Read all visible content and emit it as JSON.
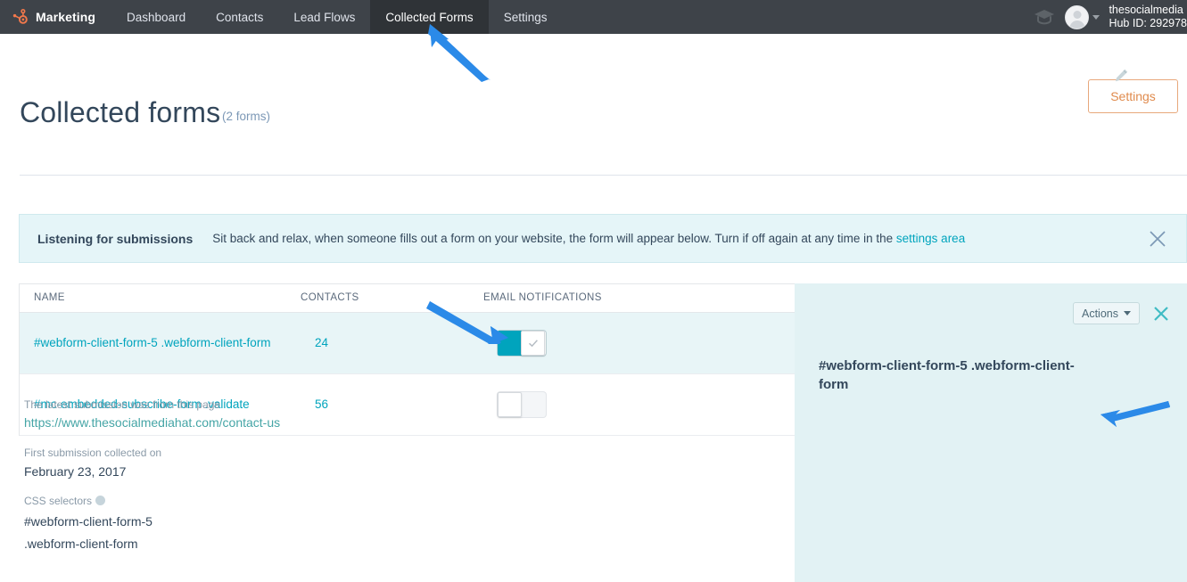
{
  "navbar": {
    "brand_icon": "hubspot-sprocket-icon",
    "brand_label": "Marketing",
    "items": [
      {
        "label": "Dashboard",
        "active": false
      },
      {
        "label": "Contacts",
        "active": false
      },
      {
        "label": "Lead Flows",
        "active": false
      },
      {
        "label": "Collected Forms",
        "active": true
      },
      {
        "label": "Settings",
        "active": false
      }
    ],
    "academy_icon": "graduation-cap-icon",
    "avatar_icon": "user-avatar-icon",
    "account_name": "thesocialmedia",
    "hub_id": "Hub ID: 292978"
  },
  "header": {
    "title": "Collected forms",
    "count": "(2 forms)",
    "settings_label": "Settings"
  },
  "banner": {
    "title": "Listening for submissions",
    "text_before": "Sit back and relax, when someone fills out a form on your website, the form will appear below. Turn if off again at any time in the ",
    "link_label": "settings area",
    "close_icon": "close-icon"
  },
  "table": {
    "columns": [
      "NAME",
      "CONTACTS",
      "EMAIL NOTIFICATIONS"
    ],
    "rows": [
      {
        "name": "#webform-client-form-5 .webform-client-form",
        "contacts": "24",
        "notifications_on": true,
        "selected": true
      },
      {
        "name": "#mc-embedded-subscribe-form .validate",
        "contacts": "56",
        "notifications_on": false,
        "selected": false
      }
    ]
  },
  "panel": {
    "actions_label": "Actions",
    "close_icon": "close-icon",
    "edit_icon": "pencil-edit-icon",
    "title": "#webform-client-form-5 .webform-client-form",
    "latest_submission_label": "The latest submission was from this page",
    "latest_submission_url": "https://www.thesocialmediahat.com/contact-us",
    "first_submission_label": "First submission collected on",
    "first_submission_date": "February 23, 2017",
    "css_selectors_label": "CSS selectors",
    "css_selectors_info_icon": "help-info-icon",
    "css_selector_1": "#webform-client-form-5",
    "css_selector_2": ".webform-client-form"
  },
  "colors": {
    "nav_bg": "#3e4349",
    "teal": "#00a4bd",
    "orange": "#e08b4d",
    "panel_bg": "#e2f2f4",
    "banner_bg": "#e5f5f8",
    "annotation_arrow": "#2b8ae8"
  },
  "annotations": [
    {
      "name": "arrow-to-collected-forms-tab"
    },
    {
      "name": "arrow-to-email-notifications-toggle"
    },
    {
      "name": "arrow-to-submission-url"
    }
  ]
}
